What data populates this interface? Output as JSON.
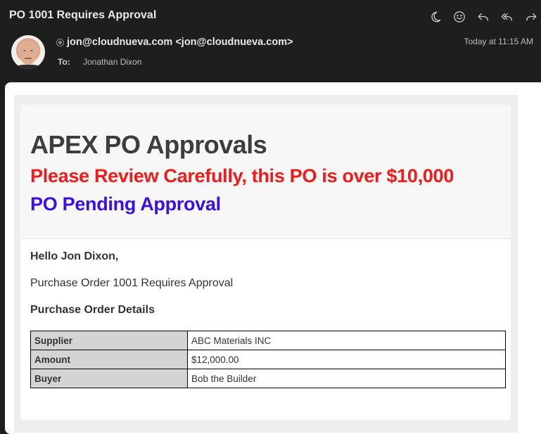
{
  "email": {
    "subject": "PO 1001 Requires Approval",
    "from": "jon@cloudnueva.com <jon@cloudnueva.com>",
    "to_label": "To:",
    "to": "Jonathan Dixon",
    "date": "Today at 11:15 AM"
  },
  "toolbar": {
    "icons": [
      "moon-icon",
      "smiley-icon",
      "reply-icon",
      "reply-all-icon",
      "forward-icon"
    ]
  },
  "message": {
    "title": "APEX PO Approvals",
    "warning": "Please Review Carefully, this PO is over $10,000",
    "pending": "PO Pending Approval",
    "greeting": "Hello Jon Dixon,",
    "intro": "Purchase Order 1001 Requires Approval",
    "details_heading": "Purchase Order Details",
    "details": [
      {
        "label": "Supplier",
        "value": "ABC Materials INC"
      },
      {
        "label": "Amount",
        "value": "$12,000.00"
      },
      {
        "label": "Buyer",
        "value": "Bob the Builder"
      }
    ]
  },
  "colors": {
    "warning": "#f01c1c",
    "pending": "#3b10e6"
  }
}
